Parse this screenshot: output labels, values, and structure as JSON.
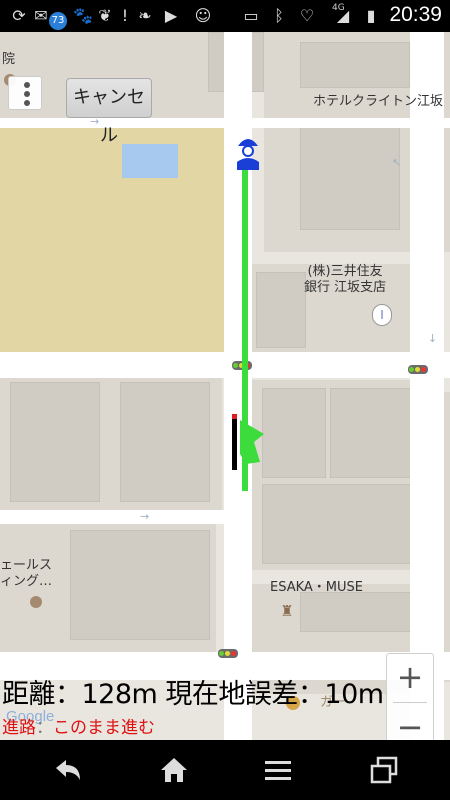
{
  "status_bar": {
    "notification_badge": "73",
    "network_label": "4G",
    "clock": "20:39"
  },
  "map": {
    "cancel_button_label": "キャンセル",
    "labels": {
      "hotel": "ホテルクライトン江坂",
      "bank_line1": "(株)三井住友",
      "bank_line2": "銀行 江坂支店",
      "muse": "ESAKA・MUSE",
      "left_top": "院",
      "left_mid_line1": "ェールス",
      "left_mid_line2": "ィング…",
      "burger_fragment": "ガー"
    },
    "google_logo": "Google",
    "zoom_in_label": "+",
    "zoom_out_label": "−"
  },
  "info": {
    "distance_line": "距離：128m 現在地誤差：10m",
    "route_label": "進路",
    "route_separator": "：",
    "route_value": "このまま進む"
  },
  "colors": {
    "route": "#3cdc3c",
    "route_text": "#e01010",
    "user_marker": "#1a3fd6"
  },
  "nav_bar": {
    "icons": [
      "back-icon",
      "home-icon",
      "menu-icon",
      "recent-apps-icon"
    ]
  }
}
